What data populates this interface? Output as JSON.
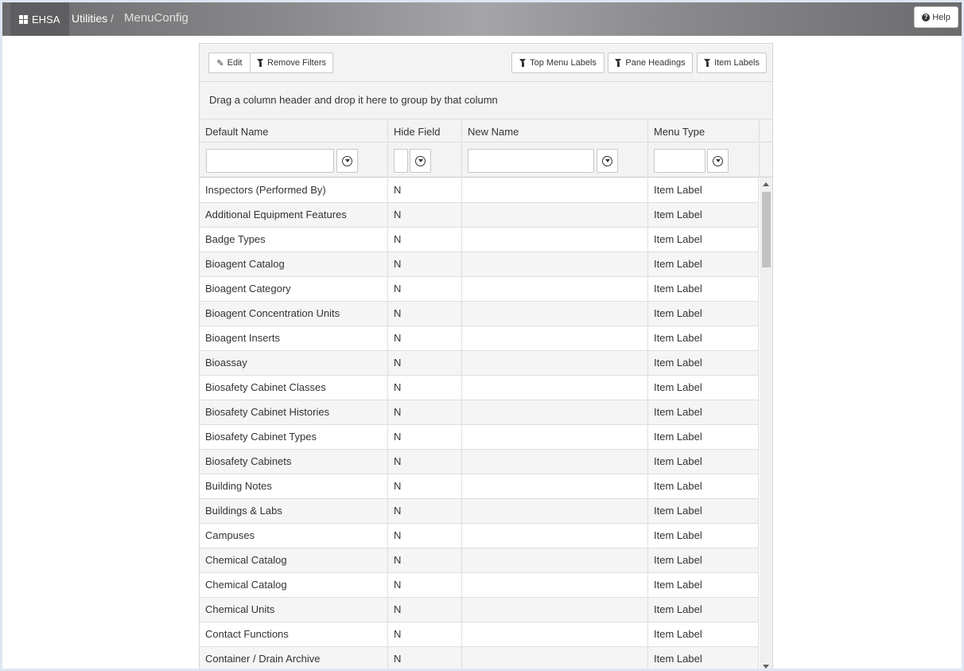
{
  "header": {
    "brand": "EHSA",
    "breadcrumb": [
      "Utilities",
      "MenuConfig"
    ],
    "breadcrumb_separator": "/",
    "help_label": "Help"
  },
  "toolbar": {
    "edit_label": "Edit",
    "remove_filters_label": "Remove Filters",
    "top_menu_labels": "Top Menu Labels",
    "pane_headings": "Pane Headings",
    "item_labels": "Item Labels"
  },
  "grid": {
    "group_hint": "Drag a column header and drop it here to group by that column",
    "columns": [
      "Default Name",
      "Hide Field",
      "New Name",
      "Menu Type"
    ],
    "rows": [
      {
        "default_name": "Inspectors (Performed By)",
        "hide_field": "N",
        "new_name": "",
        "menu_type": "Item Label"
      },
      {
        "default_name": "Additional Equipment Features",
        "hide_field": "N",
        "new_name": "",
        "menu_type": "Item Label"
      },
      {
        "default_name": "Badge Types",
        "hide_field": "N",
        "new_name": "",
        "menu_type": "Item Label"
      },
      {
        "default_name": "Bioagent Catalog",
        "hide_field": "N",
        "new_name": "",
        "menu_type": "Item Label"
      },
      {
        "default_name": "Bioagent Category",
        "hide_field": "N",
        "new_name": "",
        "menu_type": "Item Label"
      },
      {
        "default_name": "Bioagent Concentration Units",
        "hide_field": "N",
        "new_name": "",
        "menu_type": "Item Label"
      },
      {
        "default_name": "Bioagent Inserts",
        "hide_field": "N",
        "new_name": "",
        "menu_type": "Item Label"
      },
      {
        "default_name": "Bioassay",
        "hide_field": "N",
        "new_name": "",
        "menu_type": "Item Label"
      },
      {
        "default_name": "Biosafety Cabinet Classes",
        "hide_field": "N",
        "new_name": "",
        "menu_type": "Item Label"
      },
      {
        "default_name": "Biosafety Cabinet Histories",
        "hide_field": "N",
        "new_name": "",
        "menu_type": "Item Label"
      },
      {
        "default_name": "Biosafety Cabinet Types",
        "hide_field": "N",
        "new_name": "",
        "menu_type": "Item Label"
      },
      {
        "default_name": "Biosafety Cabinets",
        "hide_field": "N",
        "new_name": "",
        "menu_type": "Item Label"
      },
      {
        "default_name": "Building Notes",
        "hide_field": "N",
        "new_name": "",
        "menu_type": "Item Label"
      },
      {
        "default_name": "Buildings & Labs",
        "hide_field": "N",
        "new_name": "",
        "menu_type": "Item Label"
      },
      {
        "default_name": "Campuses",
        "hide_field": "N",
        "new_name": "",
        "menu_type": "Item Label"
      },
      {
        "default_name": "Chemical Catalog",
        "hide_field": "N",
        "new_name": "",
        "menu_type": "Item Label"
      },
      {
        "default_name": "Chemical Catalog",
        "hide_field": "N",
        "new_name": "",
        "menu_type": "Item Label"
      },
      {
        "default_name": "Chemical Units",
        "hide_field": "N",
        "new_name": "",
        "menu_type": "Item Label"
      },
      {
        "default_name": "Contact Functions",
        "hide_field": "N",
        "new_name": "",
        "menu_type": "Item Label"
      },
      {
        "default_name": "Container / Drain Archive",
        "hide_field": "N",
        "new_name": "",
        "menu_type": "Item Label"
      }
    ]
  }
}
